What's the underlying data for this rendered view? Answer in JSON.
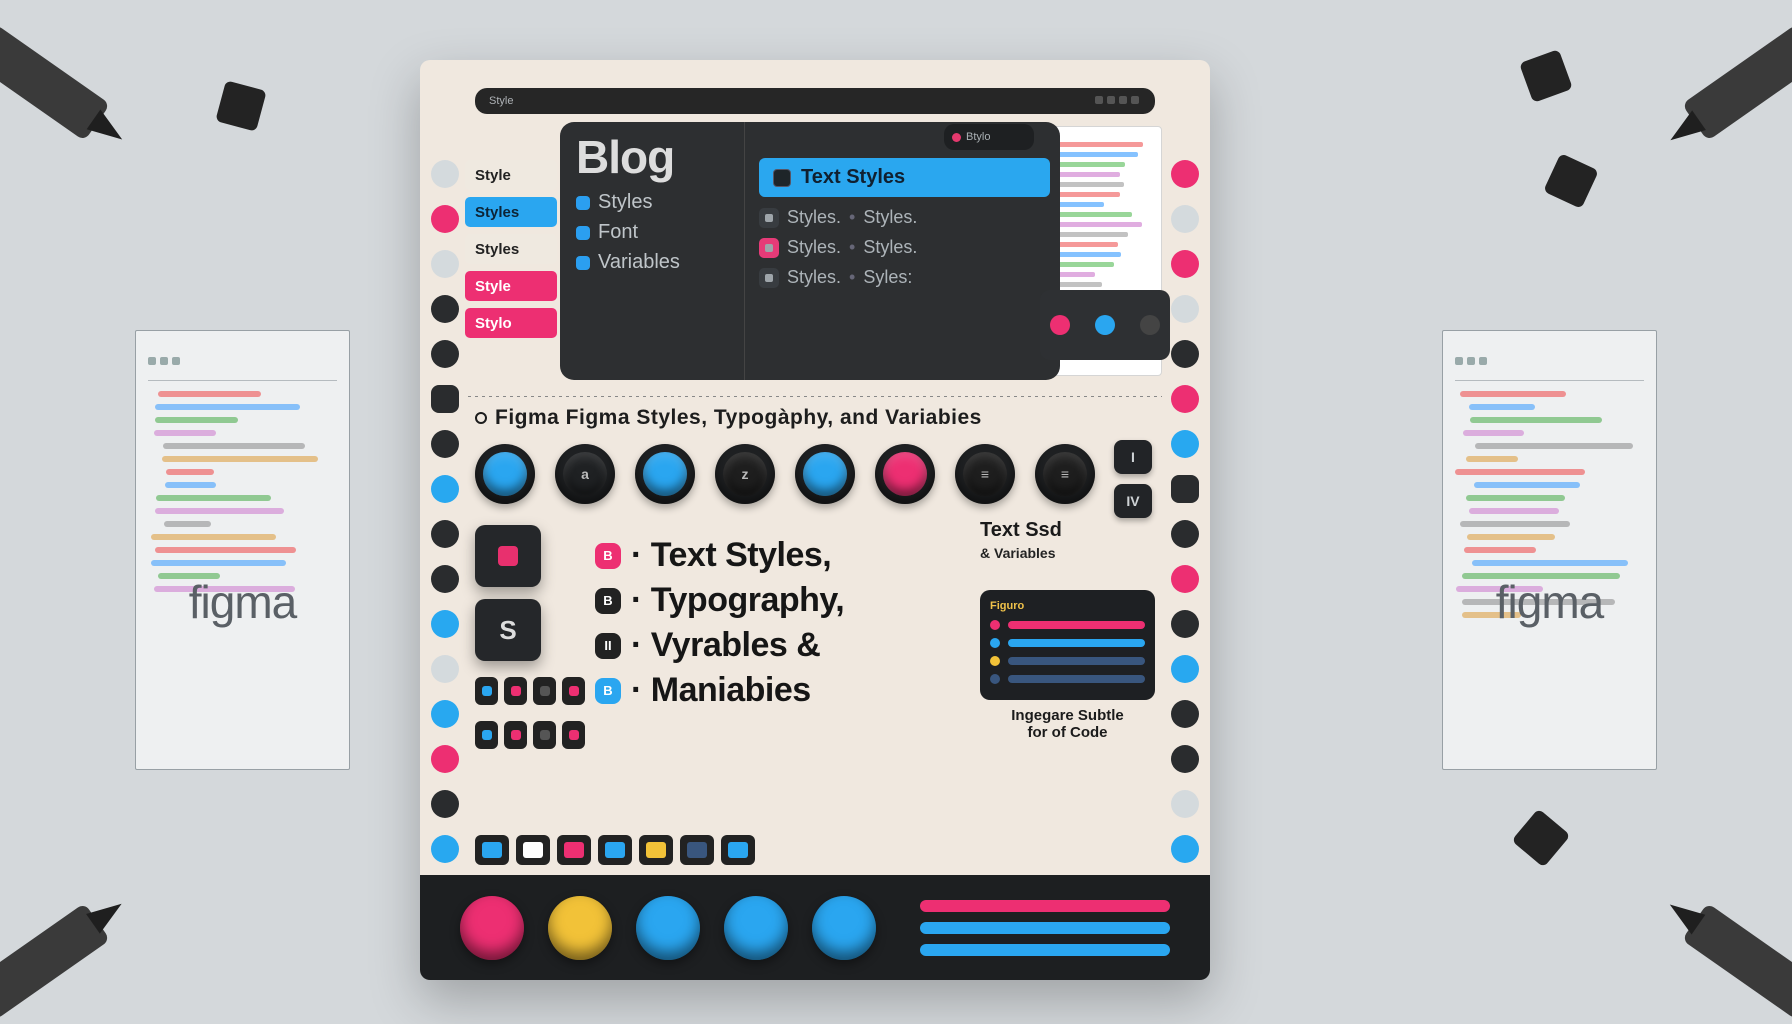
{
  "brand": "figma",
  "topstrip": {
    "left": "Style",
    "chip_label": "Btylo"
  },
  "panel": {
    "title": "Blog",
    "col1_items": [
      {
        "label": "Styles"
      },
      {
        "label": "Font"
      },
      {
        "label": "Variables"
      }
    ],
    "text_styles_pill": "Text Styles",
    "rows": [
      {
        "a": "Styles.",
        "b": "Styles."
      },
      {
        "a": "Styles.",
        "b": "Styles."
      },
      {
        "a": "Styles.",
        "b": "Syles:"
      }
    ]
  },
  "tags": [
    {
      "label": "Style",
      "variant": "plain"
    },
    {
      "label": "Styles",
      "variant": "blue"
    },
    {
      "label": "Styles",
      "variant": "plain"
    },
    {
      "label": "Style",
      "variant": "pink"
    },
    {
      "label": "Stylo",
      "variant": "pink"
    }
  ],
  "subtitle": "Figma Figma Styles, Typogàphy, and Variabies",
  "round_buttons": [
    {
      "color": "#2aa6f0",
      "glyph": ""
    },
    {
      "color": "#1f2123",
      "glyph": "a"
    },
    {
      "color": "#2aa6f0",
      "glyph": ""
    },
    {
      "color": "#1e1e1e",
      "glyph": "z"
    },
    {
      "color": "#2aa6f0",
      "glyph": ""
    },
    {
      "color": "#ed2f72",
      "glyph": ""
    },
    {
      "color": "#1e1e1e",
      "glyph": "≡"
    },
    {
      "color": "#1e1e1e",
      "glyph": "≡"
    }
  ],
  "side_squares": [
    "I",
    "IV"
  ],
  "list": [
    {
      "badge_color": "#ed2f72",
      "badge": "B",
      "text": "· Text Styles,"
    },
    {
      "badge_color": "#222",
      "badge": "B",
      "text": "· Typography,"
    },
    {
      "badge_color": "#222",
      "badge": "II",
      "text": "· Vyrables  &"
    },
    {
      "badge_color": "#2aa6f0",
      "badge": "B",
      "text": "· Maniabies"
    }
  ],
  "tiles": [
    {
      "glyph": "▮"
    },
    {
      "glyph": "S"
    }
  ],
  "mini_colors": [
    "#2aa6f0",
    "#ed2f72",
    "#555",
    "#ed2f72"
  ],
  "rcard1": {
    "line1": "Text  Ssd",
    "line2": "& Variables"
  },
  "rcard2": {
    "header": "Figuro",
    "sliders": [
      {
        "dot": "#ed2f72",
        "bar": "#ed2f72"
      },
      {
        "dot": "#2aa6f0",
        "bar": "#2aa6f0"
      },
      {
        "dot": "#f2c238",
        "bar": "#39567e"
      },
      {
        "dot": "#39567e",
        "bar": "#39567e"
      }
    ]
  },
  "rcap": {
    "line1": "Ingegare Subtle",
    "line2": "for  of Code"
  },
  "bottom_colors": [
    "#ed2f72",
    "#f2c238",
    "#2aa6f0",
    "#2aa6f0",
    "#2aa6f0"
  ],
  "bottom_bars": [
    "#ed2f72",
    "#2aa6f0",
    "#2aa6f0"
  ],
  "keys": [
    "#2aa6f0",
    "#fff",
    "#ed2f72",
    "#2aa6f0",
    "#f2c238",
    "#39567e",
    "#2aa6f0"
  ],
  "gutter_left": [
    "l",
    "pk",
    "l",
    "",
    "",
    "sq",
    "",
    "bl",
    "",
    "",
    "bl",
    "l",
    "bl",
    "pk",
    "",
    "bl",
    "l"
  ],
  "gutter_right": [
    "pk",
    "l",
    "pk",
    "l",
    "",
    "pk",
    "bl",
    "sq",
    "",
    "pk",
    "",
    "bl",
    "",
    "",
    "l",
    "bl",
    "pk"
  ],
  "colors": {
    "blue": "#2aa6f0",
    "pink": "#ed2f72",
    "yellow": "#f2c238",
    "navy": "#39567e",
    "dark": "#1e2023"
  }
}
